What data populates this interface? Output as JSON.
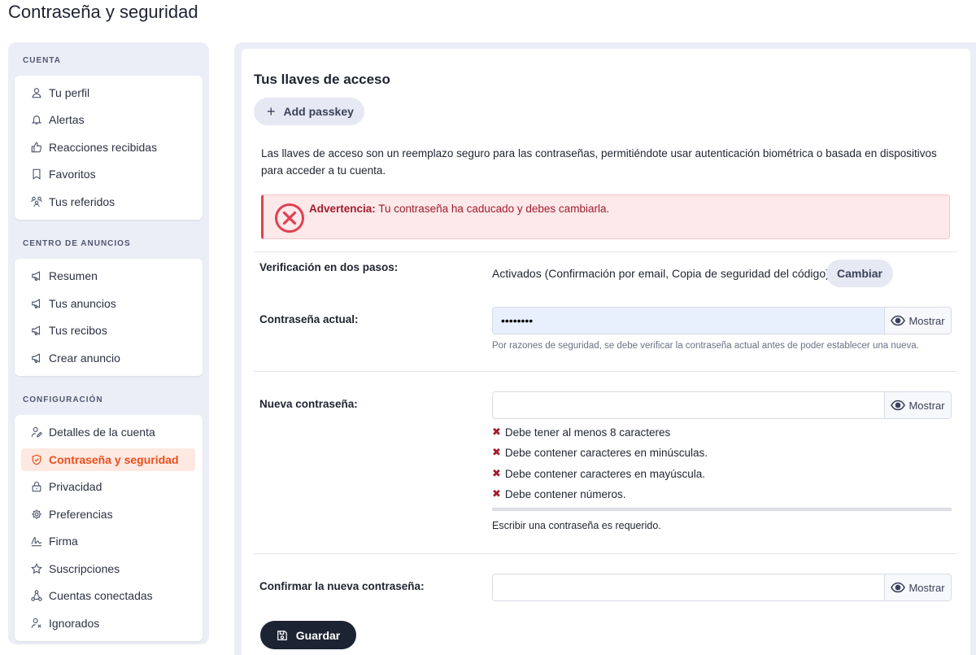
{
  "page_title": "Contraseña y seguridad",
  "sidebar": {
    "sections": [
      {
        "title": "CUENTA",
        "items": [
          {
            "label": "Tu perfil",
            "icon": "user-icon"
          },
          {
            "label": "Alertas",
            "icon": "bell-icon"
          },
          {
            "label": "Reacciones recibidas",
            "icon": "thumbs-up-icon"
          },
          {
            "label": "Favoritos",
            "icon": "bookmark-icon"
          },
          {
            "label": "Tus referidos",
            "icon": "users-icon"
          }
        ]
      },
      {
        "title": "CENTRO DE ANUNCIOS",
        "items": [
          {
            "label": "Resumen",
            "icon": "megaphone-icon"
          },
          {
            "label": "Tus anuncios",
            "icon": "megaphone-icon"
          },
          {
            "label": "Tus recibos",
            "icon": "megaphone-icon"
          },
          {
            "label": "Crear anuncio",
            "icon": "megaphone-icon"
          }
        ]
      },
      {
        "title": "CONFIGURACIÓN",
        "items": [
          {
            "label": "Detalles de la cuenta",
            "icon": "user-edit-icon"
          },
          {
            "label": "Contraseña y seguridad",
            "icon": "shield-icon",
            "active": true
          },
          {
            "label": "Privacidad",
            "icon": "lock-icon"
          },
          {
            "label": "Preferencias",
            "icon": "gear-icon"
          },
          {
            "label": "Firma",
            "icon": "signature-icon"
          },
          {
            "label": "Suscripciones",
            "icon": "star-icon"
          },
          {
            "label": "Cuentas conectadas",
            "icon": "share-icon"
          },
          {
            "label": "Ignorados",
            "icon": "user-x-icon"
          }
        ]
      }
    ]
  },
  "main": {
    "passkeys_title": "Tus llaves de acceso",
    "add_passkey_label": "Add passkey",
    "description": "Las llaves de acceso son un reemplazo seguro para las contraseñas, permitiéndote usar autenticación biométrica o basada en dispositivos para acceder a tu cuenta.",
    "alert": {
      "strong": "Advertencia:",
      "text": " Tu contraseña ha caducado y debes cambiarla."
    },
    "two_step": {
      "label": "Verificación en dos pasos:",
      "status": "Activados (Confirmación por email, Copia de seguridad del código)",
      "change_label": "Cambiar"
    },
    "current_password": {
      "label": "Contraseña actual:",
      "value": "••••••••",
      "show_label": "Mostrar",
      "hint": "Por razones de seguridad, se debe verificar la contraseña actual antes de poder establecer una nueva."
    },
    "new_password": {
      "label": "Nueva contraseña:",
      "value": "",
      "show_label": "Mostrar",
      "requirements": [
        "Debe tener al menos 8 caracteres",
        "Debe contener caracteres en minúsculas.",
        "Debe contener caracteres en mayúscula.",
        "Debe contener números."
      ],
      "requirement_mark": "✖",
      "required_message": "Escribir una contraseña es requerido."
    },
    "confirm_password": {
      "label": "Confirmar la nueva contraseña:",
      "value": "",
      "show_label": "Mostrar"
    },
    "save_label": "Guardar"
  },
  "colors": {
    "accent": "#e8501f",
    "alert_red": "#a11d2b",
    "dark_button": "#1c2433"
  }
}
